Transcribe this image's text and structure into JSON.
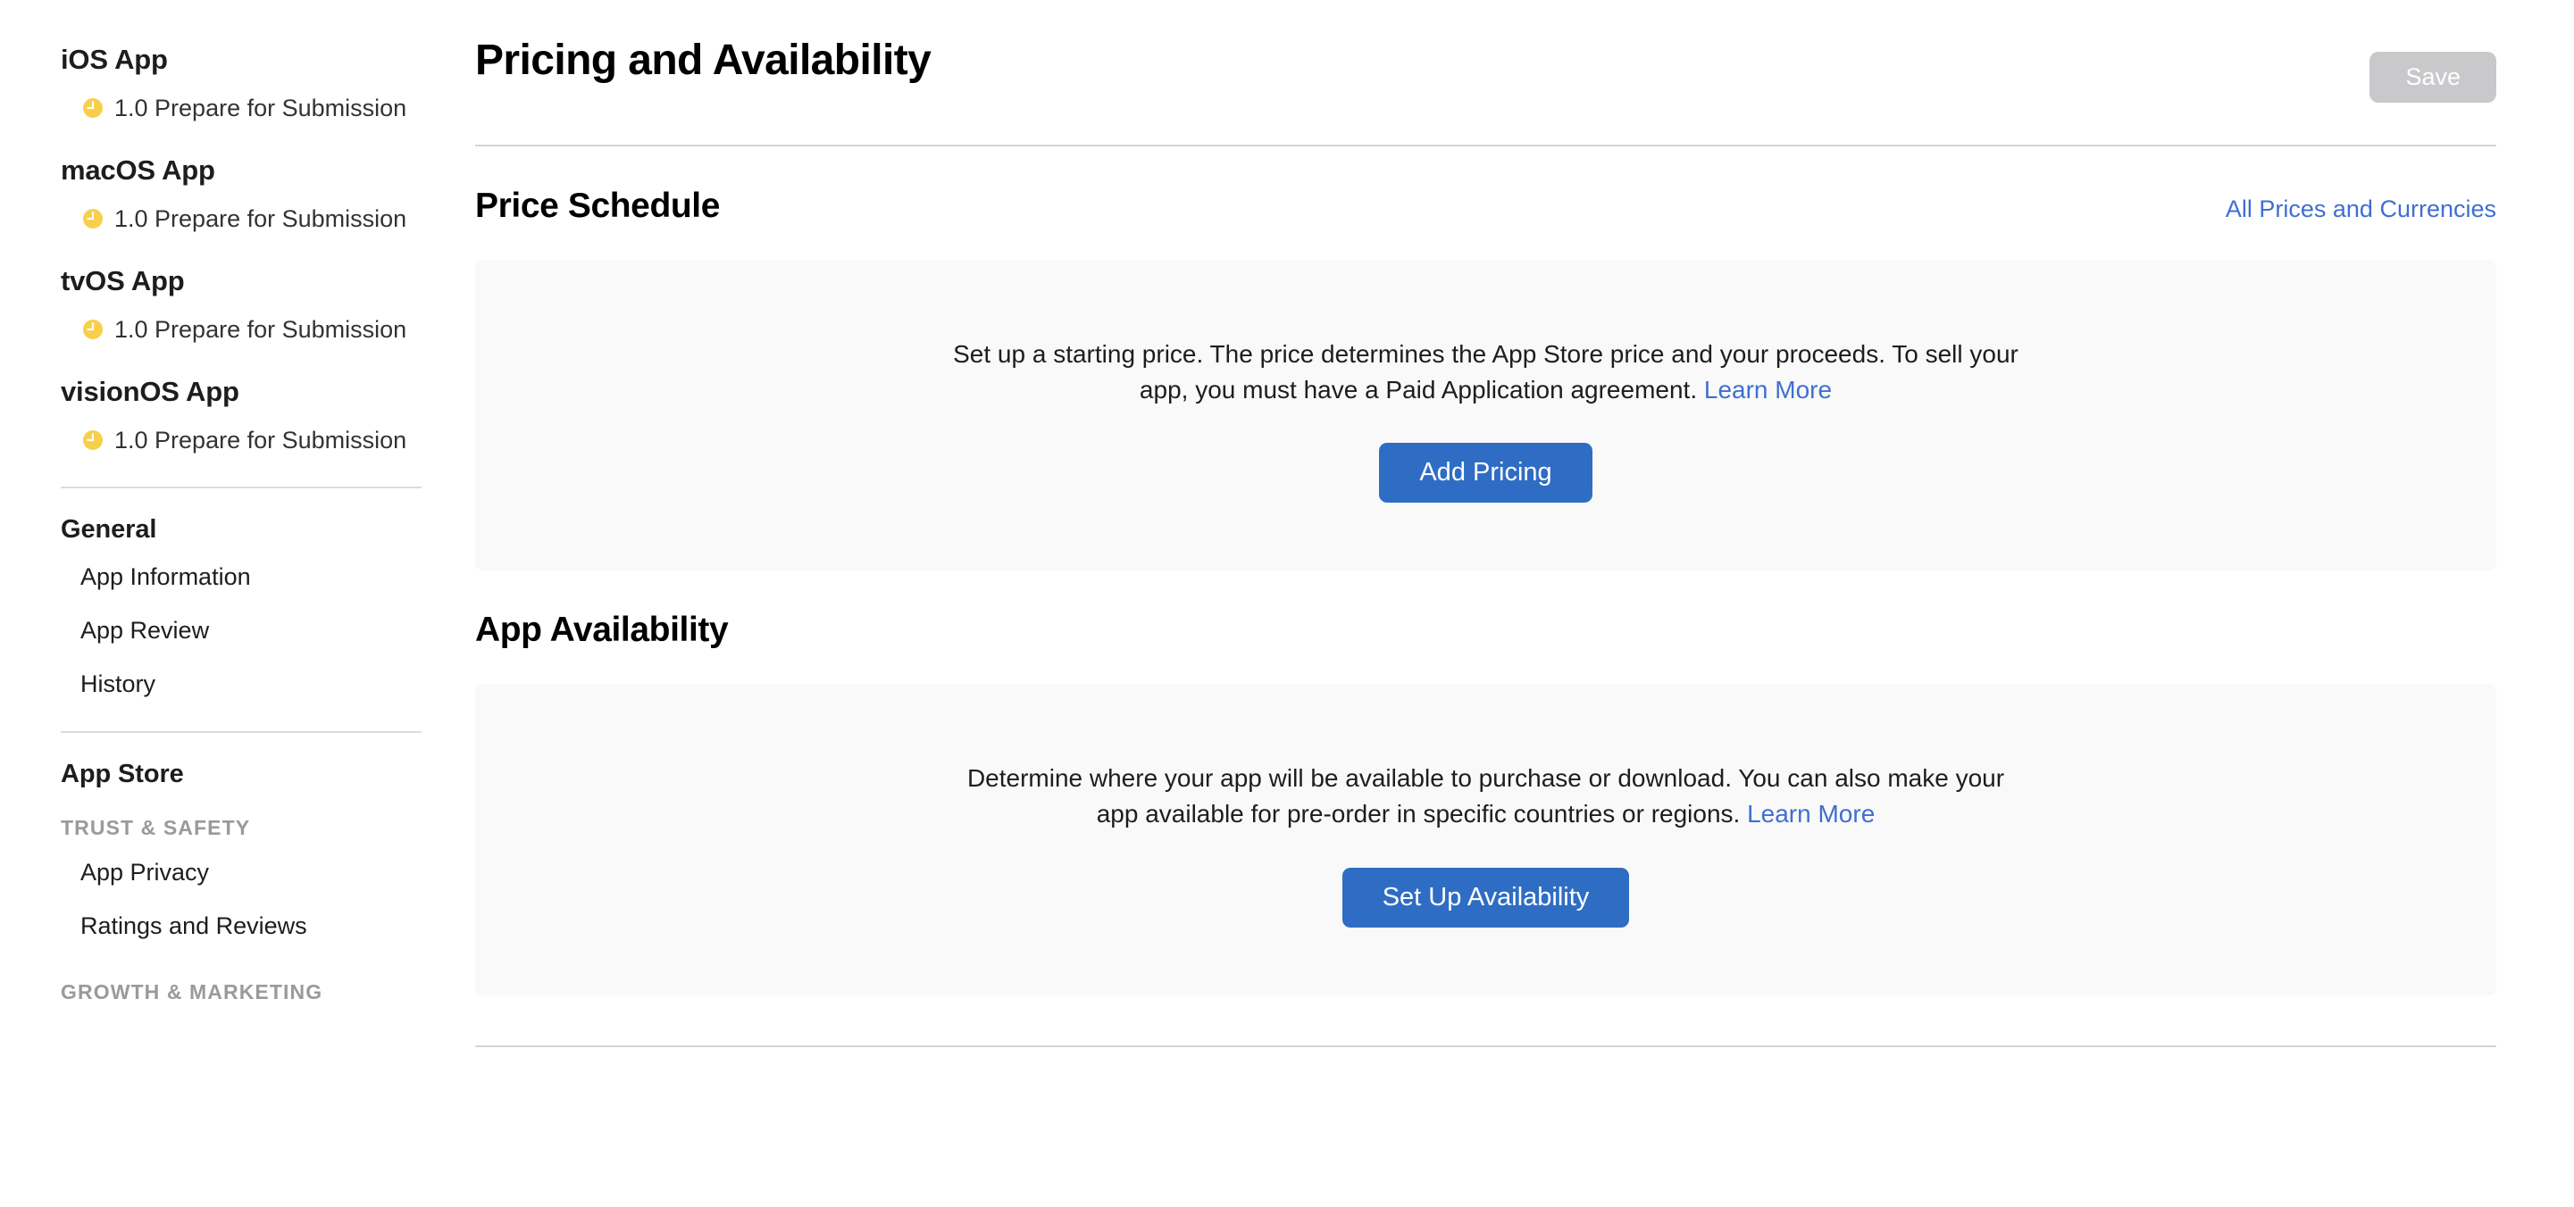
{
  "sidebar": {
    "platforms": [
      {
        "title": "iOS App",
        "status_icon": "clock-icon",
        "status": "1.0 Prepare for Submission"
      },
      {
        "title": "macOS App",
        "status_icon": "clock-icon",
        "status": "1.0 Prepare for Submission"
      },
      {
        "title": "tvOS App",
        "status_icon": "clock-icon",
        "status": "1.0 Prepare for Submission"
      },
      {
        "title": "visionOS App",
        "status_icon": "clock-icon",
        "status": "1.0 Prepare for Submission"
      }
    ],
    "general": {
      "title": "General",
      "items": [
        "App Information",
        "App Review",
        "History"
      ]
    },
    "app_store": {
      "title": "App Store",
      "trust_safety_caption": "TRUST & SAFETY",
      "trust_safety_items": [
        "App Privacy",
        "Ratings and Reviews"
      ],
      "growth_caption": "GROWTH & MARKETING"
    }
  },
  "header": {
    "title": "Pricing and Availability",
    "save_label": "Save"
  },
  "price_schedule": {
    "title": "Price Schedule",
    "link_label": "All Prices and Currencies",
    "description": "Set up a starting price. The price determines the App Store price and your proceeds. To sell your app, you must have a Paid Application agreement.",
    "learn_more": "Learn More",
    "cta_label": "Add Pricing"
  },
  "app_availability": {
    "title": "App Availability",
    "description": "Determine where your app will be available to purchase or download. You can also make your app available for pre-order in specific countries or regions.",
    "learn_more": "Learn More",
    "cta_label": "Set Up Availability"
  },
  "colors": {
    "accent_blue": "#2f6dc4",
    "link_blue": "#3f6fd0",
    "status_yellow": "#f7cf4a",
    "card_bg": "#f9f9fa",
    "disabled_gray": "#c9c9cb"
  }
}
